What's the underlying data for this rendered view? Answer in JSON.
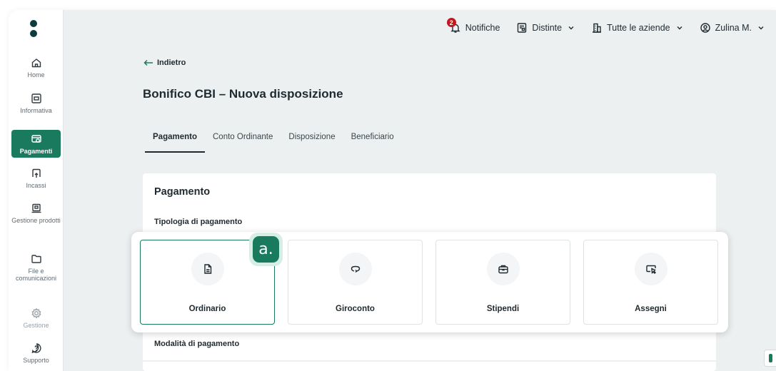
{
  "sidebar": {
    "items": [
      {
        "label": "Home",
        "icon": "home-icon"
      },
      {
        "label": "Informativa",
        "icon": "report-icon"
      },
      {
        "label": "Pagamenti",
        "icon": "payments-icon",
        "active": true
      },
      {
        "label": "Incassi",
        "icon": "collection-icon"
      },
      {
        "label": "Gestione prodotti",
        "icon": "products-icon"
      },
      {
        "label": "File e comunicazioni",
        "icon": "folder-icon"
      },
      {
        "label": "Gestione",
        "icon": "gear-icon",
        "disabled": true
      },
      {
        "label": "Supporto",
        "icon": "support-icon"
      }
    ]
  },
  "topbar": {
    "notifications_label": "Notifiche",
    "notifications_count": "2",
    "distinte_label": "Distinte",
    "company_label": "Tutte le aziende",
    "user_label": "Zulina M."
  },
  "main": {
    "back_label": "Indietro",
    "page_title": "Bonifico CBI – Nuova disposizione",
    "tabs": [
      {
        "label": "Pagamento",
        "active": true
      },
      {
        "label": "Conto Ordinante"
      },
      {
        "label": "Disposizione"
      },
      {
        "label": "Beneficiario"
      }
    ],
    "card": {
      "title": "Pagamento",
      "type_heading": "Tipologia di pagamento",
      "mode_heading": "Modalità di pagamento",
      "options": [
        {
          "label": "Ordinario",
          "icon": "document-icon",
          "selected": true
        },
        {
          "label": "Giroconto",
          "icon": "loop-arrow-icon"
        },
        {
          "label": "Stipendi",
          "icon": "briefcase-icon"
        },
        {
          "label": "Assegni",
          "icon": "cheque-icon"
        }
      ]
    },
    "step_marker": "a."
  },
  "colors": {
    "accent": "#1a7a5e",
    "badge": "#c4161c",
    "background": "#edf0f1"
  }
}
